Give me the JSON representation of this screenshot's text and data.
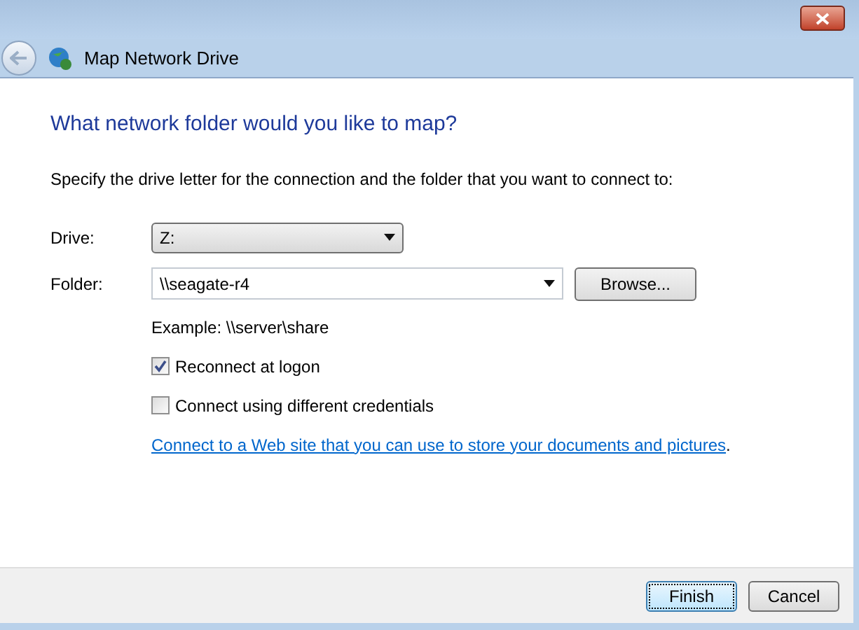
{
  "window": {
    "title": "Map Network Drive"
  },
  "heading": "What network folder would you like to map?",
  "instruction": "Specify the drive letter for the connection and the folder that you want to connect to:",
  "drive": {
    "label": "Drive:",
    "value": "Z:"
  },
  "folder": {
    "label": "Folder:",
    "value": "\\\\seagate-r4",
    "browse": "Browse..."
  },
  "example": "Example: \\\\server\\share",
  "options": [
    {
      "label": "Reconnect at logon",
      "checked": true
    },
    {
      "label": "Connect using different credentials",
      "checked": false
    }
  ],
  "link": {
    "text": "Connect to a Web site that you can use to store your documents and pictures",
    "suffix": "."
  },
  "buttons": [
    {
      "label": "Finish",
      "default": true
    },
    {
      "label": "Cancel",
      "default": false
    }
  ]
}
